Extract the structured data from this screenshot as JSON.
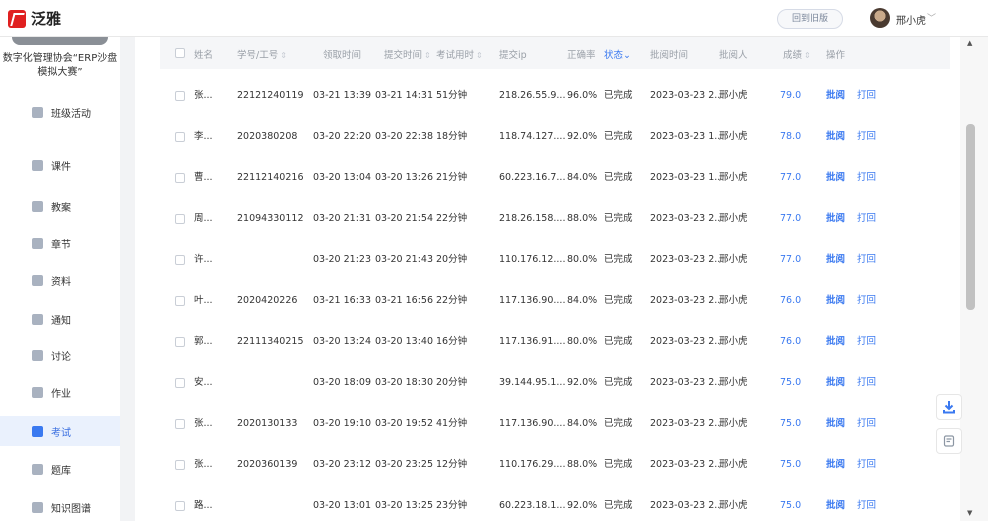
{
  "app": {
    "brand": "泛雅"
  },
  "header": {
    "back_label": "回到旧版",
    "user_name": "邢小虎",
    "chevron": "﹀"
  },
  "sidebar": {
    "course_name": "数字化管理协会“ERP沙盘模拟大赛”",
    "items": [
      {
        "label": "班级活动",
        "icon": "grid-icon"
      },
      {
        "label": "课件",
        "icon": "courseware-icon"
      },
      {
        "label": "教案",
        "icon": "lesson-plan-icon"
      },
      {
        "label": "章节",
        "icon": "chapter-icon"
      },
      {
        "label": "资料",
        "icon": "folder-icon"
      },
      {
        "label": "通知",
        "icon": "speaker-icon"
      },
      {
        "label": "讨论",
        "icon": "chat-icon"
      },
      {
        "label": "作业",
        "icon": "homework-icon"
      },
      {
        "label": "考试",
        "icon": "exam-icon",
        "active": true
      },
      {
        "label": "题库",
        "icon": "question-bank-icon"
      },
      {
        "label": "知识图谱",
        "icon": "knowledge-graph-icon"
      }
    ]
  },
  "table": {
    "headers": {
      "name": "姓名",
      "id": "学号/工号",
      "get_time": "领取时间",
      "submit_time": "提交时间",
      "duration": "考试用时",
      "ip": "提交ip",
      "accuracy": "正确率",
      "status": "状态",
      "review_time": "批阅时间",
      "reviewer": "批阅人",
      "score": "成绩",
      "ops": "操作"
    },
    "sort_glyph": "⇕",
    "status_chevron": "⌄",
    "actions": {
      "review": "批阅",
      "return": "打回"
    },
    "rows": [
      {
        "name": "张...",
        "id": "22121240119",
        "get": "03-21 13:39",
        "submit": "03-21 14:31",
        "dur": "51分钟",
        "ip": "218.26.55.9...",
        "acc": "96.0%",
        "status": "已完成",
        "rtime": "2023-03-23 2...",
        "reviewer": "邢小虎",
        "score": "79.0"
      },
      {
        "name": "李...",
        "id": "2020380208",
        "get": "03-20 22:20",
        "submit": "03-20 22:38",
        "dur": "18分钟",
        "ip": "118.74.127....",
        "acc": "92.0%",
        "status": "已完成",
        "rtime": "2023-03-23 1...",
        "reviewer": "邢小虎",
        "score": "78.0"
      },
      {
        "name": "曹...",
        "id": "22112140216",
        "get": "03-20 13:04",
        "submit": "03-20 13:26",
        "dur": "21分钟",
        "ip": "60.223.16.7...",
        "acc": "84.0%",
        "status": "已完成",
        "rtime": "2023-03-23 1...",
        "reviewer": "邢小虎",
        "score": "77.0"
      },
      {
        "name": "周...",
        "id": "21094330112",
        "get": "03-20 21:31",
        "submit": "03-20 21:54",
        "dur": "22分钟",
        "ip": "218.26.158....",
        "acc": "88.0%",
        "status": "已完成",
        "rtime": "2023-03-23 2...",
        "reviewer": "邢小虎",
        "score": "77.0"
      },
      {
        "name": "许...",
        "id": "",
        "get": "03-20 21:23",
        "submit": "03-20 21:43",
        "dur": "20分钟",
        "ip": "110.176.12....",
        "acc": "80.0%",
        "status": "已完成",
        "rtime": "2023-03-23 2...",
        "reviewer": "邢小虎",
        "score": "77.0"
      },
      {
        "name": "叶...",
        "id": "2020420226",
        "get": "03-21 16:33",
        "submit": "03-21 16:56",
        "dur": "22分钟",
        "ip": "117.136.90....",
        "acc": "84.0%",
        "status": "已完成",
        "rtime": "2023-03-23 2...",
        "reviewer": "邢小虎",
        "score": "76.0"
      },
      {
        "name": "郭...",
        "id": "22111340215",
        "get": "03-20 13:24",
        "submit": "03-20 13:40",
        "dur": "16分钟",
        "ip": "117.136.91....",
        "acc": "80.0%",
        "status": "已完成",
        "rtime": "2023-03-23 2...",
        "reviewer": "邢小虎",
        "score": "76.0"
      },
      {
        "name": "安...",
        "id": "",
        "get": "03-20 18:09",
        "submit": "03-20 18:30",
        "dur": "20分钟",
        "ip": "39.144.95.1...",
        "acc": "92.0%",
        "status": "已完成",
        "rtime": "2023-03-23 2...",
        "reviewer": "邢小虎",
        "score": "75.0"
      },
      {
        "name": "张...",
        "id": "2020130133",
        "get": "03-20 19:10",
        "submit": "03-20 19:52",
        "dur": "41分钟",
        "ip": "117.136.90....",
        "acc": "84.0%",
        "status": "已完成",
        "rtime": "2023-03-23 2...",
        "reviewer": "邢小虎",
        "score": "75.0"
      },
      {
        "name": "张...",
        "id": "2020360139",
        "get": "03-20 23:12",
        "submit": "03-20 23:25",
        "dur": "12分钟",
        "ip": "110.176.29....",
        "acc": "88.0%",
        "status": "已完成",
        "rtime": "2023-03-23 2...",
        "reviewer": "邢小虎",
        "score": "75.0"
      },
      {
        "name": "路...",
        "id": "",
        "get": "03-20 13:01",
        "submit": "03-20 13:25",
        "dur": "23分钟",
        "ip": "60.223.18.1...",
        "acc": "92.0%",
        "status": "已完成",
        "rtime": "2023-03-23 2...",
        "reviewer": "邢小虎",
        "score": "75.0"
      }
    ]
  },
  "floating": {
    "download_icon": "download-icon",
    "notes_icon": "notes-icon"
  },
  "colors": {
    "accent": "#3a79f0",
    "brand_red": "#e02020"
  }
}
